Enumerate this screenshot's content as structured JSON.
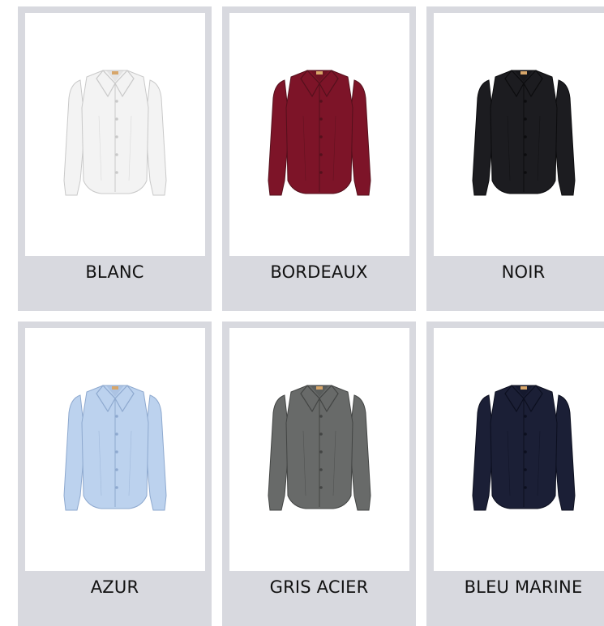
{
  "products": [
    {
      "label": "BLANC",
      "icon": "shirt-icon",
      "color": "#f3f3f3",
      "stroke": "#c9c9c9",
      "accent": "#d7a66a"
    },
    {
      "label": "BORDEAUX",
      "icon": "shirt-icon",
      "color": "#7d1428",
      "stroke": "#55101c",
      "accent": "#d7a66a"
    },
    {
      "label": "NOIR",
      "icon": "shirt-icon",
      "color": "#1c1c20",
      "stroke": "#0c0c0e",
      "accent": "#d7a66a"
    },
    {
      "label": "AZUR",
      "icon": "shirt-icon",
      "color": "#bcd2ee",
      "stroke": "#8ea9cf",
      "accent": "#d7a66a"
    },
    {
      "label": "GRIS ACIER",
      "icon": "shirt-icon",
      "color": "#686a69",
      "stroke": "#434544",
      "accent": "#d7a66a"
    },
    {
      "label": "BLEU MARINE",
      "icon": "shirt-icon",
      "color": "#1b1f36",
      "stroke": "#0c0f1f",
      "accent": "#d7a66a"
    }
  ]
}
